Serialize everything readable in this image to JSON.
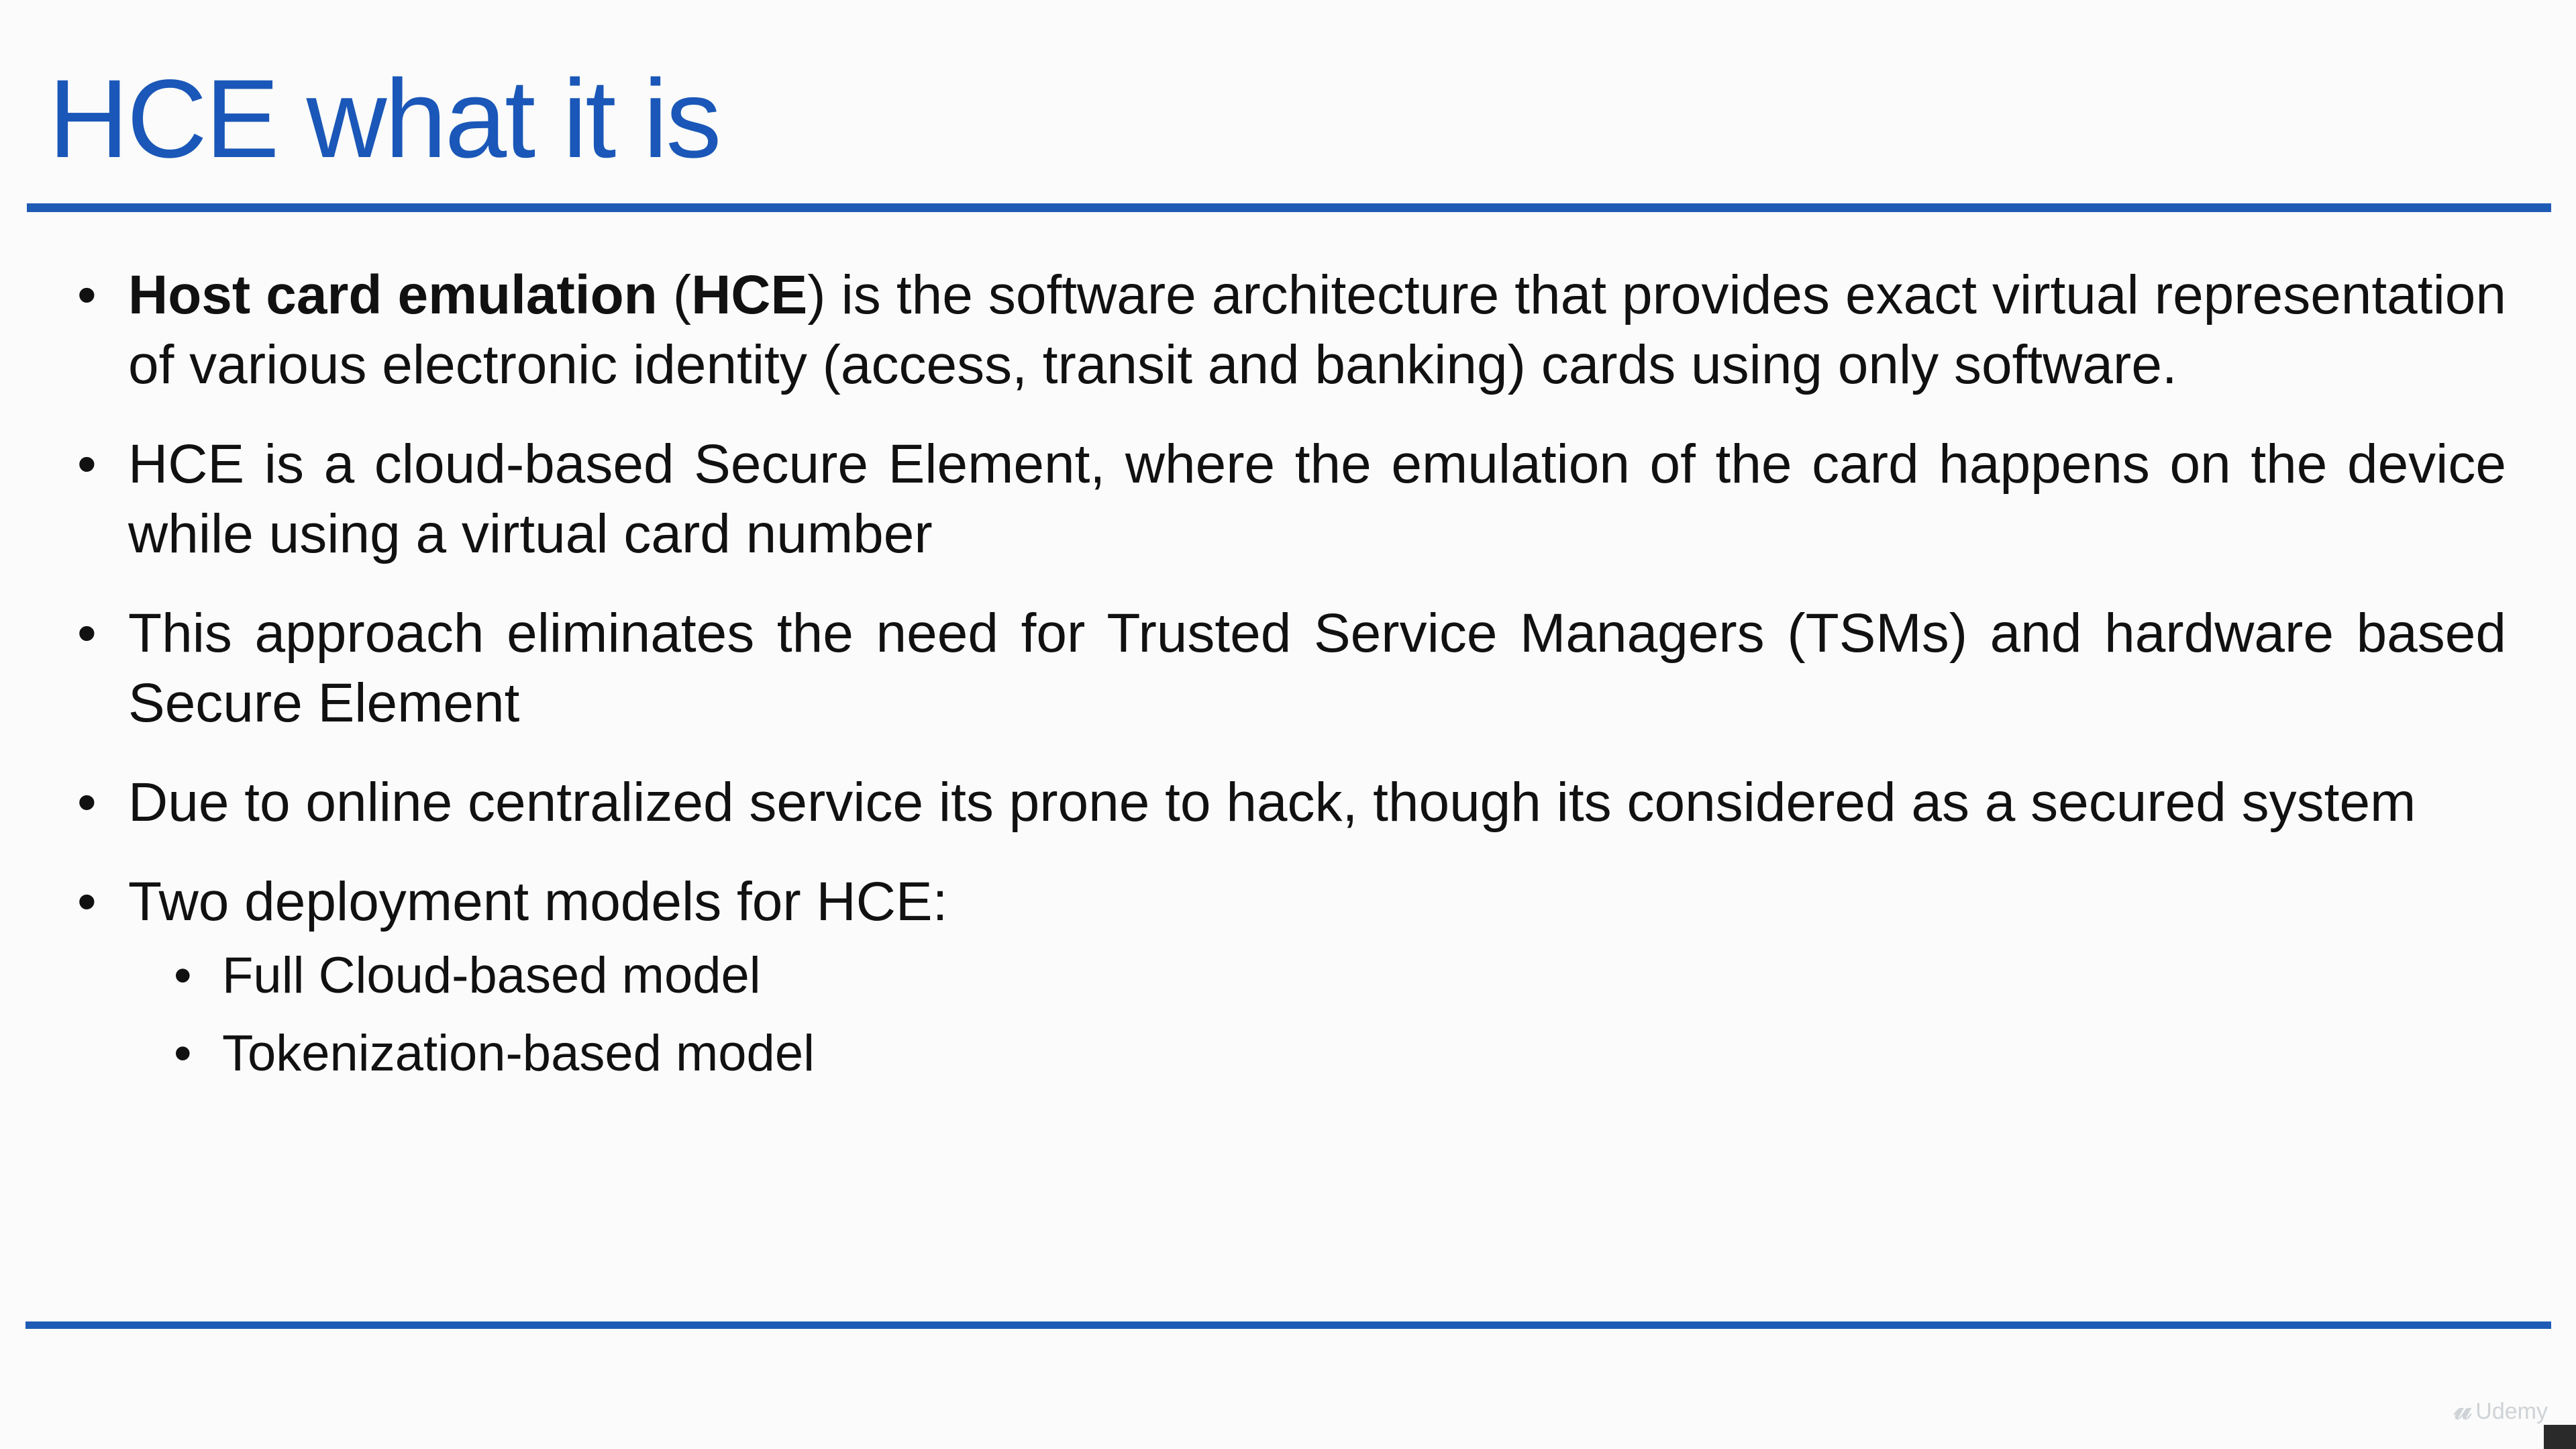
{
  "slide": {
    "title": "HCE what it is",
    "bullets": [
      {
        "term": "Host card emulation",
        "open_paren": " (",
        "abbr": "HCE",
        "rest": ") is the software architecture that provides exact virtual representation of various electronic identity (access, transit and banking) cards using only software."
      },
      {
        "text": "HCE is a cloud-based Secure Element, where the emulation of the card happens on the device while using a virtual card number"
      },
      {
        "text": "This approach eliminates the need for Trusted Service Managers (TSMs) and hardware based Secure Element"
      },
      {
        "text": "Due to online centralized service its prone to hack, though its considered as a secured system"
      },
      {
        "text": "Two deployment models for HCE:",
        "sub_items": [
          "Full Cloud-based model",
          "Tokenization-based model"
        ]
      }
    ]
  },
  "watermark": {
    "icon": "udemy-logo-icon",
    "text": "Udemy"
  },
  "colors": {
    "title": "#1a57b8",
    "rule": "#1e5bb5",
    "background": "#fafbfa",
    "text": "#111111"
  }
}
